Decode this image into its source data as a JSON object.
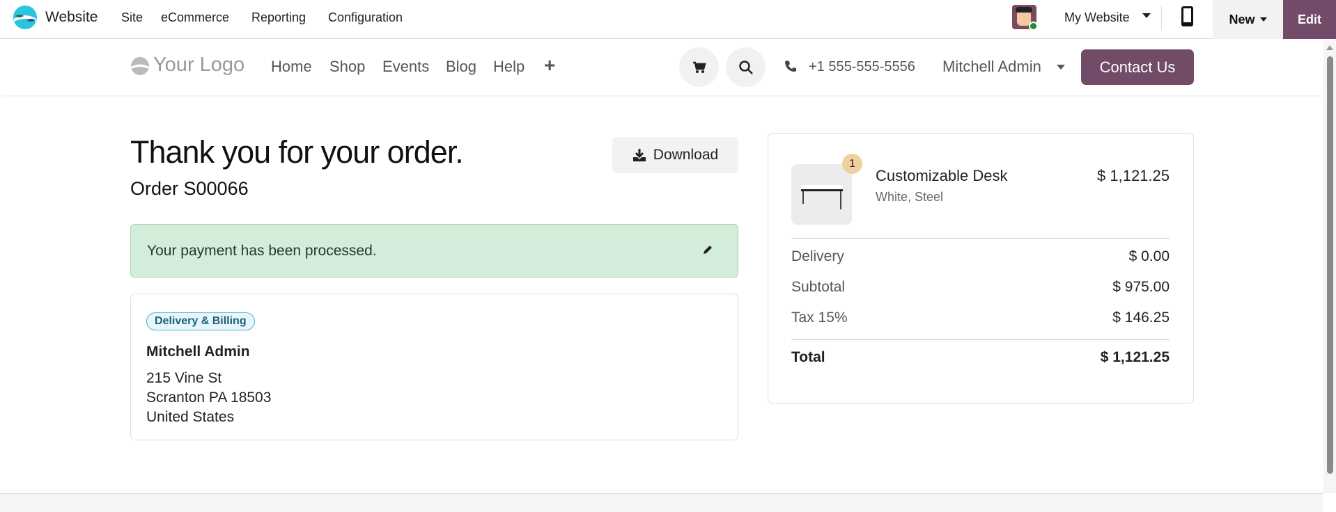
{
  "topbar": {
    "app_name": "Website",
    "menu": [
      "Site",
      "eCommerce",
      "Reporting",
      "Configuration"
    ],
    "website_selector": "My Website",
    "new_label": "New",
    "edit_label": "Edit"
  },
  "navbar": {
    "logo": "Your Logo",
    "links": [
      "Home",
      "Shop",
      "Events",
      "Blog",
      "Help"
    ],
    "add": "+",
    "phone": "+1 555-555-5556",
    "user": "Mitchell Admin",
    "contact": "Contact Us"
  },
  "order": {
    "title": "Thank you for your order.",
    "number": "Order S00066",
    "download": "Download",
    "alert": "Your payment has been processed."
  },
  "address": {
    "badge": "Delivery & Billing",
    "name": "Mitchell Admin",
    "lines": [
      "215 Vine St",
      "Scranton PA 18503",
      "United States"
    ]
  },
  "summary": {
    "item": {
      "qty": "1",
      "name": "Customizable Desk",
      "variant": "White, Steel",
      "price": "$ 1,121.25"
    },
    "rows": [
      {
        "label": "Delivery",
        "value": "$ 0.00"
      },
      {
        "label": "Subtotal",
        "value": "$ 975.00"
      },
      {
        "label": "Tax 15%",
        "value": "$ 146.25"
      }
    ],
    "total": {
      "label": "Total",
      "value": "$ 1,121.25"
    }
  },
  "colors": {
    "brand": "#714b67",
    "alert_bg": "#d4edda",
    "alert_border": "#a3d9b1",
    "badge_bg": "#e6f6fb",
    "badge_border": "#4fb3cf",
    "qty_badge": "#f0cfa0"
  }
}
